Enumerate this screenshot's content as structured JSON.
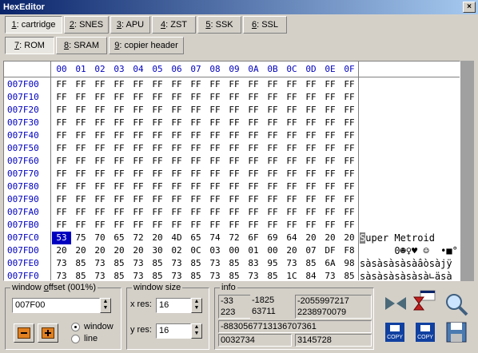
{
  "title": "HexEditor",
  "tabs1": [
    {
      "key": "1",
      "label": ": cartridge",
      "sel": true
    },
    {
      "key": "2",
      "label": ": SNES"
    },
    {
      "key": "3",
      "label": ": APU"
    },
    {
      "key": "4",
      "label": ": ZST"
    },
    {
      "key": "5",
      "label": ": SSK"
    },
    {
      "key": "6",
      "label": ": SSL"
    }
  ],
  "tabs2": [
    {
      "key": "7",
      "label": ": ROM",
      "sel": true
    },
    {
      "key": "8",
      "label": ": SRAM"
    },
    {
      "key": "9",
      "label": ": copier header"
    }
  ],
  "cols": [
    "00",
    "01",
    "02",
    "03",
    "04",
    "05",
    "06",
    "07",
    "08",
    "09",
    "0A",
    "0B",
    "0C",
    "0D",
    "0E",
    "0F"
  ],
  "rows": [
    {
      "addr": "007F00",
      "bytes": [
        "FF",
        "FF",
        "FF",
        "FF",
        "FF",
        "FF",
        "FF",
        "FF",
        "FF",
        "FF",
        "FF",
        "FF",
        "FF",
        "FF",
        "FF",
        "FF"
      ],
      "ascii": ""
    },
    {
      "addr": "007F10",
      "bytes": [
        "FF",
        "FF",
        "FF",
        "FF",
        "FF",
        "FF",
        "FF",
        "FF",
        "FF",
        "FF",
        "FF",
        "FF",
        "FF",
        "FF",
        "FF",
        "FF"
      ],
      "ascii": ""
    },
    {
      "addr": "007F20",
      "bytes": [
        "FF",
        "FF",
        "FF",
        "FF",
        "FF",
        "FF",
        "FF",
        "FF",
        "FF",
        "FF",
        "FF",
        "FF",
        "FF",
        "FF",
        "FF",
        "FF"
      ],
      "ascii": ""
    },
    {
      "addr": "007F30",
      "bytes": [
        "FF",
        "FF",
        "FF",
        "FF",
        "FF",
        "FF",
        "FF",
        "FF",
        "FF",
        "FF",
        "FF",
        "FF",
        "FF",
        "FF",
        "FF",
        "FF"
      ],
      "ascii": ""
    },
    {
      "addr": "007F40",
      "bytes": [
        "FF",
        "FF",
        "FF",
        "FF",
        "FF",
        "FF",
        "FF",
        "FF",
        "FF",
        "FF",
        "FF",
        "FF",
        "FF",
        "FF",
        "FF",
        "FF"
      ],
      "ascii": ""
    },
    {
      "addr": "007F50",
      "bytes": [
        "FF",
        "FF",
        "FF",
        "FF",
        "FF",
        "FF",
        "FF",
        "FF",
        "FF",
        "FF",
        "FF",
        "FF",
        "FF",
        "FF",
        "FF",
        "FF"
      ],
      "ascii": ""
    },
    {
      "addr": "007F60",
      "bytes": [
        "FF",
        "FF",
        "FF",
        "FF",
        "FF",
        "FF",
        "FF",
        "FF",
        "FF",
        "FF",
        "FF",
        "FF",
        "FF",
        "FF",
        "FF",
        "FF"
      ],
      "ascii": ""
    },
    {
      "addr": "007F70",
      "bytes": [
        "FF",
        "FF",
        "FF",
        "FF",
        "FF",
        "FF",
        "FF",
        "FF",
        "FF",
        "FF",
        "FF",
        "FF",
        "FF",
        "FF",
        "FF",
        "FF"
      ],
      "ascii": ""
    },
    {
      "addr": "007F80",
      "bytes": [
        "FF",
        "FF",
        "FF",
        "FF",
        "FF",
        "FF",
        "FF",
        "FF",
        "FF",
        "FF",
        "FF",
        "FF",
        "FF",
        "FF",
        "FF",
        "FF"
      ],
      "ascii": ""
    },
    {
      "addr": "007F90",
      "bytes": [
        "FF",
        "FF",
        "FF",
        "FF",
        "FF",
        "FF",
        "FF",
        "FF",
        "FF",
        "FF",
        "FF",
        "FF",
        "FF",
        "FF",
        "FF",
        "FF"
      ],
      "ascii": ""
    },
    {
      "addr": "007FA0",
      "bytes": [
        "FF",
        "FF",
        "FF",
        "FF",
        "FF",
        "FF",
        "FF",
        "FF",
        "FF",
        "FF",
        "FF",
        "FF",
        "FF",
        "FF",
        "FF",
        "FF"
      ],
      "ascii": ""
    },
    {
      "addr": "007FB0",
      "bytes": [
        "FF",
        "FF",
        "FF",
        "FF",
        "FF",
        "FF",
        "FF",
        "FF",
        "FF",
        "FF",
        "FF",
        "FF",
        "FF",
        "FF",
        "FF",
        "FF"
      ],
      "ascii": ""
    },
    {
      "addr": "007FC0",
      "bytes": [
        "53",
        "75",
        "70",
        "65",
        "72",
        "20",
        "4D",
        "65",
        "74",
        "72",
        "6F",
        "69",
        "64",
        "20",
        "20",
        "20"
      ],
      "ascii": "Super Metroid"
    },
    {
      "addr": "007FD0",
      "bytes": [
        "20",
        "20",
        "20",
        "20",
        "20",
        "30",
        "02",
        "0C",
        "03",
        "00",
        "01",
        "00",
        "20",
        "07",
        "DF",
        "F8"
      ],
      "ascii": "      0☻♀♥ ☺  •■°"
    },
    {
      "addr": "007FE0",
      "bytes": [
        "73",
        "85",
        "73",
        "85",
        "73",
        "85",
        "73",
        "85",
        "73",
        "85",
        "83",
        "95",
        "73",
        "85",
        "6A",
        "98"
      ],
      "ascii": "sàsàsàsàsàâòsàjÿ"
    },
    {
      "addr": "007FF0",
      "bytes": [
        "73",
        "85",
        "73",
        "85",
        "73",
        "85",
        "73",
        "85",
        "73",
        "85",
        "73",
        "85",
        "1C",
        "84",
        "73",
        "85"
      ],
      "ascii": "sàsàsàsàsàsà∟äsà"
    }
  ],
  "offset": {
    "label_pre": "window ",
    "label_u": "o",
    "label_post": "ffset (001%)",
    "value": "007F00"
  },
  "mode": {
    "window": "window",
    "line": "line"
  },
  "size": {
    "label": "window size",
    "xres_label": "x res:",
    "xres": "16",
    "yres_label": "y res:",
    "yres": "16"
  },
  "info": {
    "label": "info",
    "a": "-33",
    "b": "-1825",
    "c": "-2055997217",
    "d": "223",
    "e": "63711",
    "f": "2238970079",
    "g": "-8830567713136707361",
    "h": "0032734",
    "i": "3145728"
  },
  "tools": {
    "copy1": "COPY",
    "copy2": "COPY"
  }
}
